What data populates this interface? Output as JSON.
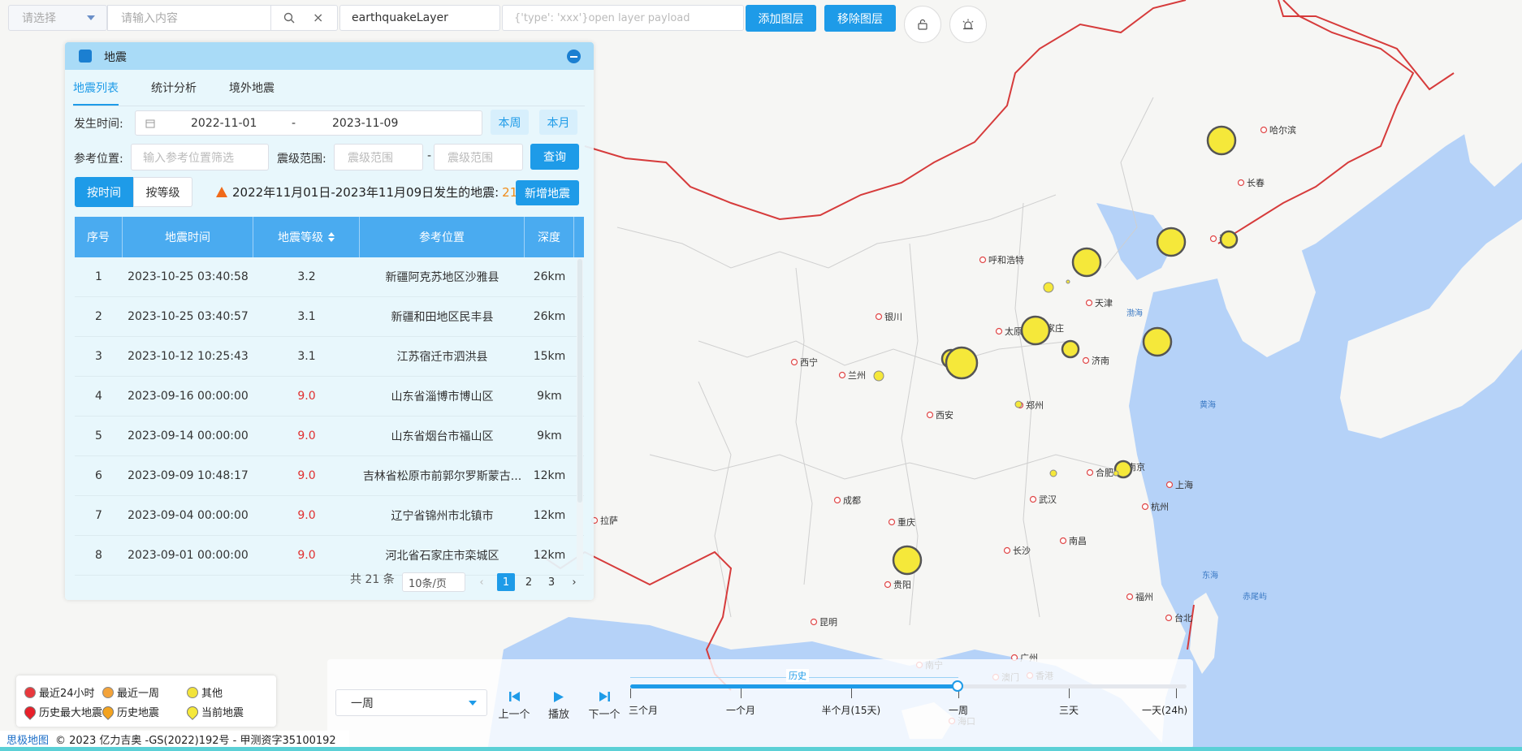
{
  "toolbar": {
    "select_placeholder": "请选择",
    "search_placeholder": "请输入内容",
    "layer_value": "earthquakeLayer",
    "payload_placeholder": "{'type': 'xxx'}open layer payload",
    "add_layer_label": "添加图层",
    "remove_layer_label": "移除图层"
  },
  "panel": {
    "title": "地震",
    "tabs": [
      "地震列表",
      "统计分析",
      "境外地震"
    ],
    "filters": {
      "time_label": "发生时间:",
      "date_start": "2022-11-01",
      "date_sep": "-",
      "date_end": "2023-11-09",
      "week_label": "本周",
      "month_label": "本月",
      "ref_label": "参考位置:",
      "ref_placeholder": "输入参考位置筛选",
      "mag_label": "震级范围:",
      "mag_min_placeholder": "震级范围",
      "mag_sep": "-",
      "mag_max_placeholder": "震级范围",
      "query_label": "查询"
    },
    "toggle": {
      "by_time": "按时间",
      "by_level": "按等级"
    },
    "summary": {
      "prefix": "2022年11月01日-2023年11月09日发生的地震:",
      "count": "21",
      "unit": "次"
    },
    "add_label": "新增地震",
    "table": {
      "headers": [
        "序号",
        "地震时间",
        "地震等级",
        "参考位置",
        "深度"
      ],
      "rows": [
        {
          "no": "1",
          "time": "2023-10-25 03:40:58",
          "mag": "3.2",
          "place": "新疆阿克苏地区沙雅县",
          "depth": "26km",
          "high": false
        },
        {
          "no": "2",
          "time": "2023-10-25 03:40:57",
          "mag": "3.1",
          "place": "新疆和田地区民丰县",
          "depth": "26km",
          "high": false
        },
        {
          "no": "3",
          "time": "2023-10-12 10:25:43",
          "mag": "3.1",
          "place": "江苏宿迁市泗洪县",
          "depth": "15km",
          "high": false
        },
        {
          "no": "4",
          "time": "2023-09-16 00:00:00",
          "mag": "9.0",
          "place": "山东省淄博市博山区",
          "depth": "9km",
          "high": true
        },
        {
          "no": "5",
          "time": "2023-09-14 00:00:00",
          "mag": "9.0",
          "place": "山东省烟台市福山区",
          "depth": "9km",
          "high": true
        },
        {
          "no": "6",
          "time": "2023-09-09 10:48:17",
          "mag": "9.0",
          "place": "吉林省松原市前郭尔罗斯蒙古...",
          "depth": "12km",
          "high": true
        },
        {
          "no": "7",
          "time": "2023-09-04 00:00:00",
          "mag": "9.0",
          "place": "辽宁省锦州市北镇市",
          "depth": "12km",
          "high": true
        },
        {
          "no": "8",
          "time": "2023-09-01 00:00:00",
          "mag": "9.0",
          "place": "河北省石家庄市栾城区",
          "depth": "12km",
          "high": true
        }
      ]
    },
    "pager": {
      "total": "共 21 条",
      "page_size": "10条/页",
      "pages": [
        "1",
        "2",
        "3"
      ],
      "current": "1"
    }
  },
  "legend": [
    {
      "label": "最近24小时",
      "color": "#e8393d",
      "shape": "dot"
    },
    {
      "label": "最近一周",
      "color": "#f3a33a",
      "shape": "dot"
    },
    {
      "label": "其他",
      "color": "#f2e33a",
      "shape": "dot"
    },
    {
      "label": "历史最大地震",
      "color": "#e8202a",
      "shape": "pin"
    },
    {
      "label": "历史地震",
      "color": "#f3a320",
      "shape": "pin"
    },
    {
      "label": "当前地震",
      "color": "#f5e83a",
      "shape": "pin"
    }
  ],
  "timeline": {
    "range_value": "一周",
    "prev_label": "上一个",
    "play_label": "播放",
    "next_label": "下一个",
    "history_label": "历史",
    "ticks": [
      "三个月",
      "一个月",
      "半个月(15天)",
      "一周",
      "三天",
      "一天(24h)"
    ]
  },
  "map": {
    "cities": [
      "哈尔滨",
      "长春",
      "沈阳",
      "呼和浩特",
      "天津",
      "石家庄",
      "太原",
      "济南",
      "银川",
      "西宁",
      "兰州",
      "西安",
      "郑州",
      "合肥",
      "南京",
      "上海",
      "杭州",
      "武汉",
      "成都",
      "重庆",
      "长沙",
      "南昌",
      "福州",
      "台北",
      "贵阳",
      "昆明",
      "拉萨",
      "南宁",
      "广州",
      "香港",
      "澳门",
      "海口"
    ],
    "seas": [
      "渤海",
      "黄海",
      "东海",
      "赤尾屿"
    ]
  },
  "attribution": {
    "logo": "思极地图",
    "text": "© 2023 亿力吉奥 -GS(2022)192号 - 甲测资字35100192"
  },
  "colors": {
    "accent": "#1e9be8",
    "header": "#4aabf0",
    "sea": "#b5d2f8",
    "quake": "#f5e83a",
    "border": "#d63b3b"
  }
}
